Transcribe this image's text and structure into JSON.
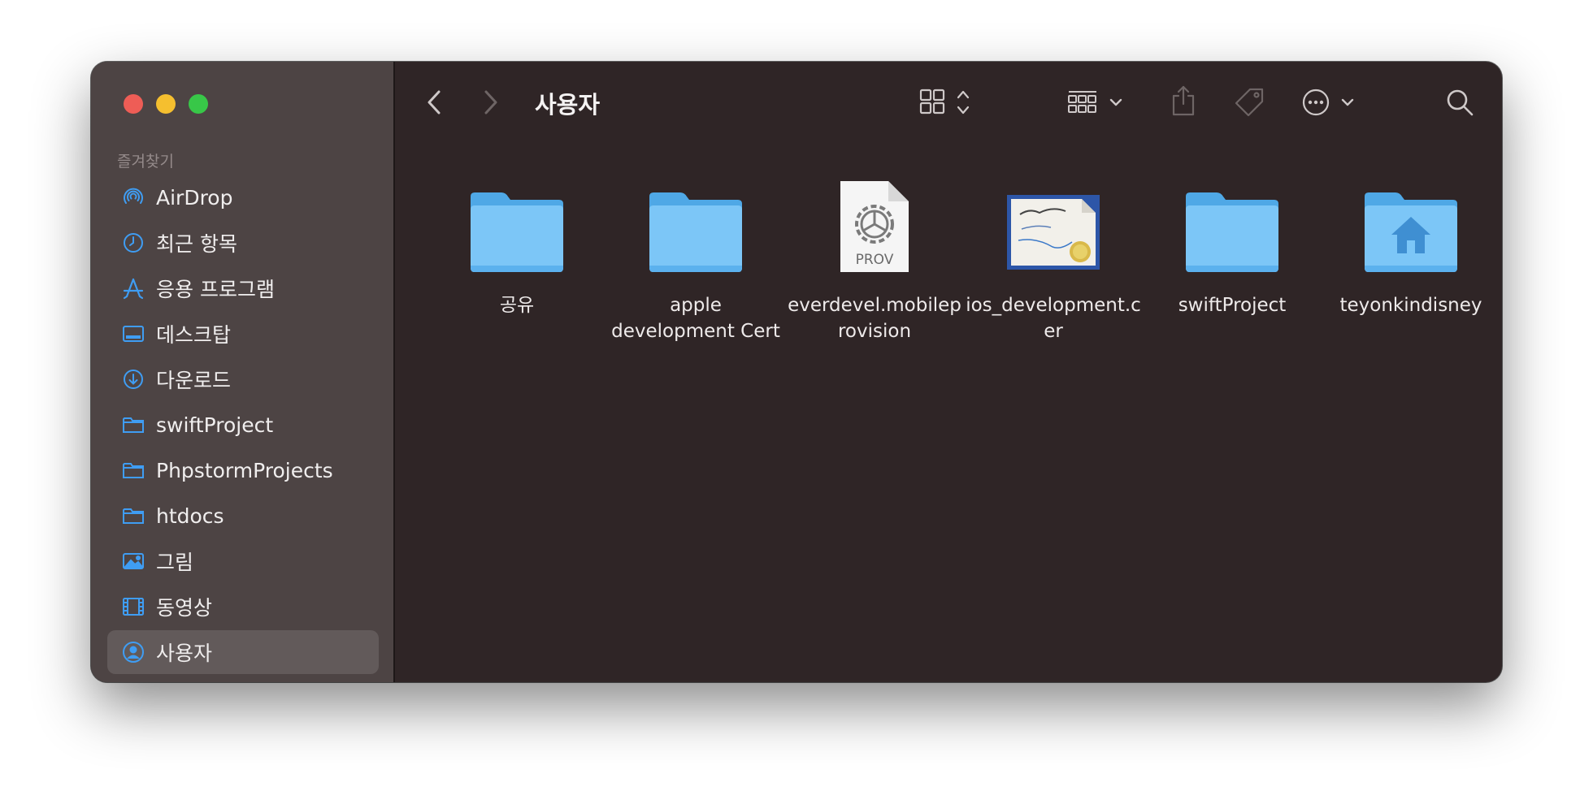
{
  "sidebar": {
    "section_label": "즐겨찾기",
    "items": [
      {
        "label": "AirDrop",
        "icon": "airdrop-icon"
      },
      {
        "label": "최근 항목",
        "icon": "clock-icon"
      },
      {
        "label": "응용 프로그램",
        "icon": "applications-icon"
      },
      {
        "label": "데스크탑",
        "icon": "desktop-icon"
      },
      {
        "label": "다운로드",
        "icon": "download-icon"
      },
      {
        "label": "swiftProject",
        "icon": "folder-icon"
      },
      {
        "label": "PhpstormProjects",
        "icon": "folder-icon"
      },
      {
        "label": "htdocs",
        "icon": "folder-icon"
      },
      {
        "label": "그림",
        "icon": "pictures-icon"
      },
      {
        "label": "동영상",
        "icon": "movies-icon"
      },
      {
        "label": "사용자",
        "icon": "user-icon",
        "selected": true
      }
    ]
  },
  "toolbar": {
    "title": "사용자"
  },
  "files": [
    {
      "name": "공유",
      "type": "folder"
    },
    {
      "name": "apple development Cert",
      "type": "folder"
    },
    {
      "name": "everdevel.mobileprovision",
      "type": "provision",
      "badge": "PROV"
    },
    {
      "name": "ios_development.cer",
      "type": "certificate"
    },
    {
      "name": "swiftProject",
      "type": "folder"
    },
    {
      "name": "teyonkindisney",
      "type": "home-folder"
    }
  ],
  "colors": {
    "accent": "#3f9df3",
    "folder": "#7cc6f7",
    "window_bg": "#2f2526",
    "sidebar_bg": "#4d4444"
  }
}
